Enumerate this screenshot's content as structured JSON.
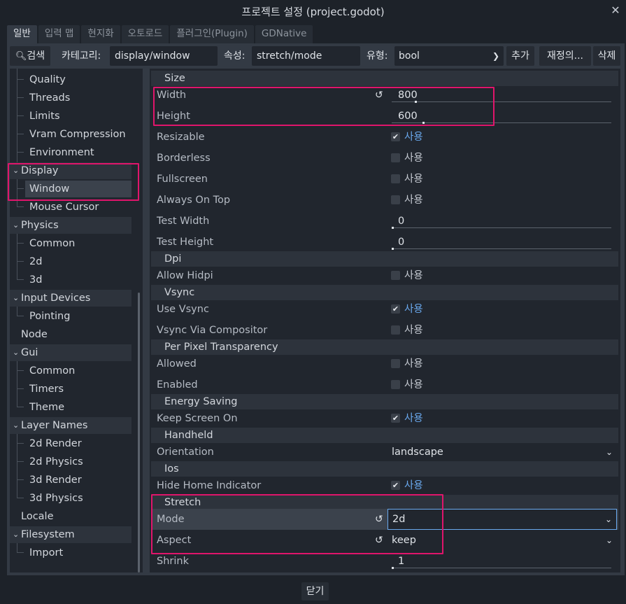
{
  "window": {
    "title": "프로젝트 설정 (project.godot)"
  },
  "tabs": [
    "일반",
    "입력 맵",
    "현지화",
    "오토로드",
    "플러그인(Plugin)",
    "GDNative"
  ],
  "toolbar": {
    "search_label": "검색",
    "category_label": "카테고리:",
    "category_value": "display/window",
    "property_label": "속성:",
    "property_value": "stretch/mode",
    "type_label": "유형:",
    "type_value": "bool",
    "add_label": "추가",
    "override_label": "재정의...",
    "delete_label": "삭제"
  },
  "tree": {
    "items": [
      "Quality",
      "Threads",
      "Limits",
      "Vram Compression",
      "Environment",
      "Display",
      "Window",
      "Mouse Cursor",
      "Physics",
      "Common",
      "2d",
      "3d",
      "Input Devices",
      "Pointing",
      "Node",
      "Gui",
      "Common",
      "Timers",
      "Theme",
      "Layer Names",
      "2d Render",
      "2d Physics",
      "3d Render",
      "3d Physics",
      "Locale",
      "Filesystem",
      "Import"
    ]
  },
  "inspector": {
    "sections": {
      "size": "Size",
      "dpi": "Dpi",
      "vsync": "Vsync",
      "ppt": "Per Pixel Transparency",
      "energy": "Energy Saving",
      "handheld": "Handheld",
      "ios": "Ios",
      "stretch": "Stretch"
    },
    "enabled_text": "사용",
    "props": {
      "width": {
        "label": "Width",
        "value": "800"
      },
      "height": {
        "label": "Height",
        "value": "600"
      },
      "resizable": {
        "label": "Resizable",
        "checked": true
      },
      "borderless": {
        "label": "Borderless",
        "checked": false
      },
      "fullscreen": {
        "label": "Fullscreen",
        "checked": false
      },
      "always_on_top": {
        "label": "Always On Top",
        "checked": false
      },
      "test_width": {
        "label": "Test Width",
        "value": "0"
      },
      "test_height": {
        "label": "Test Height",
        "value": "0"
      },
      "allow_hidpi": {
        "label": "Allow Hidpi",
        "checked": false
      },
      "use_vsync": {
        "label": "Use Vsync",
        "checked": true
      },
      "vsync_via_compositor": {
        "label": "Vsync Via Compositor",
        "checked": false
      },
      "allowed": {
        "label": "Allowed",
        "checked": false
      },
      "enabled": {
        "label": "Enabled",
        "checked": false
      },
      "keep_screen_on": {
        "label": "Keep Screen On",
        "checked": true
      },
      "orientation": {
        "label": "Orientation",
        "value": "landscape"
      },
      "hide_home_indicator": {
        "label": "Hide Home Indicator",
        "checked": true
      },
      "mode": {
        "label": "Mode",
        "value": "2d"
      },
      "aspect": {
        "label": "Aspect",
        "value": "keep"
      },
      "shrink": {
        "label": "Shrink",
        "value": "1"
      }
    }
  },
  "footer": {
    "close_label": "닫기"
  },
  "colors": {
    "highlight": "#e0156b",
    "accent": "#6aa9ee",
    "panel": "#333a44",
    "field": "#21262e"
  }
}
